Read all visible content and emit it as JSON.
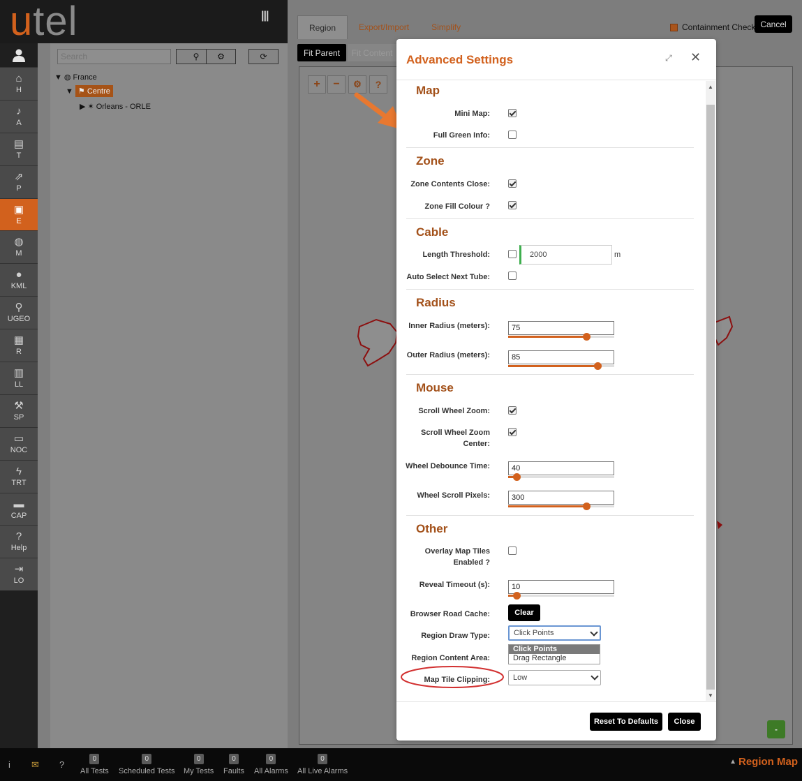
{
  "logo": {
    "u": "u",
    "rest": "tel"
  },
  "nav": [
    {
      "key": "home",
      "icon": "home-icon",
      "glyph": "⌂",
      "label": "H"
    },
    {
      "key": "alarms",
      "icon": "bell-icon",
      "glyph": "♪",
      "label": "A"
    },
    {
      "key": "tests",
      "icon": "chart-icon",
      "glyph": "▤",
      "label": "T"
    },
    {
      "key": "p",
      "icon": "share-icon",
      "glyph": "⇗",
      "label": "P"
    },
    {
      "key": "e",
      "icon": "chip-icon",
      "glyph": "▣",
      "label": "E",
      "active": true
    },
    {
      "key": "map",
      "icon": "globe-icon",
      "glyph": "◍",
      "label": "M"
    },
    {
      "key": "kml",
      "icon": "map-marker-icon",
      "glyph": "●",
      "label": "KML"
    },
    {
      "key": "ugeo",
      "icon": "pin-icon",
      "glyph": "⚲",
      "label": "UGEO"
    },
    {
      "key": "r",
      "icon": "document-icon",
      "glyph": "▦",
      "label": "R"
    },
    {
      "key": "ll",
      "icon": "book-icon",
      "glyph": "▥",
      "label": "LL"
    },
    {
      "key": "sp",
      "icon": "wrench-icon",
      "glyph": "⚒",
      "label": "SP"
    },
    {
      "key": "noc",
      "icon": "laptop-icon",
      "glyph": "▭",
      "label": "NOC"
    },
    {
      "key": "trt",
      "icon": "bolt-icon",
      "glyph": "ϟ",
      "label": "TRT"
    },
    {
      "key": "cap",
      "icon": "warehouse-icon",
      "glyph": "▬",
      "label": "CAP"
    },
    {
      "key": "help",
      "icon": "question-icon",
      "glyph": "?",
      "label": "Help"
    },
    {
      "key": "lo",
      "icon": "logout-icon",
      "glyph": "⇥",
      "label": "LO"
    }
  ],
  "tree": {
    "search_placeholder": "Search",
    "root": "France",
    "child": "Centre",
    "leaf": "Orleans - ORLE"
  },
  "tabs": [
    "Region",
    "Export/Import",
    "Simplify"
  ],
  "toolbar": {
    "containment_label": "Containment Checks",
    "cancel_label": "Cancel",
    "fit_parent": "Fit Parent",
    "fit_content": "Fit Content"
  },
  "map_tools": {
    "zoom_in": "+",
    "zoom_out": "−",
    "settings": "⚙",
    "help": "?"
  },
  "modal": {
    "title": "Advanced Settings",
    "sections": {
      "map": {
        "title": "Map",
        "mini_map_label": "Mini Map:",
        "mini_map_checked": true,
        "full_green_label": "Full Green Info:",
        "full_green_checked": false
      },
      "zone": {
        "title": "Zone",
        "contents_close_label": "Zone Contents Close:",
        "fill_colour_label": "Zone Fill Colour ?"
      },
      "cable": {
        "title": "Cable",
        "length_label": "Length Threshold:",
        "length_value": "2000",
        "length_unit": "m",
        "auto_select_label": "Auto Select Next Tube:"
      },
      "radius": {
        "title": "Radius",
        "inner_label": "Inner Radius (meters):",
        "inner_value": "75",
        "inner_fraction": 0.74,
        "outer_label": "Outer Radius (meters):",
        "outer_value": "85",
        "outer_fraction": 0.84
      },
      "mouse": {
        "title": "Mouse",
        "scroll_zoom_label": "Scroll Wheel Zoom:",
        "scroll_zoom_center_label_1": "Scroll Wheel Zoom",
        "scroll_zoom_center_label_2": "Center:",
        "debounce_label": "Wheel Debounce Time:",
        "debounce_value": "40",
        "debounce_fraction": 0.08,
        "scroll_pixels_label": "Wheel Scroll Pixels:",
        "scroll_pixels_value": "300",
        "scroll_pixels_fraction": 0.74
      },
      "other": {
        "title": "Other",
        "overlay_label_1": "Overlay Map Tiles",
        "overlay_label_2": "Enabled ?",
        "reveal_label": "Reveal Timeout (s):",
        "reveal_value": "10",
        "reveal_fraction": 0.08,
        "cache_label": "Browser Road Cache:",
        "clear_label": "Clear",
        "draw_type_label": "Region Draw Type:",
        "draw_type_value": "Click Points",
        "draw_type_options": [
          "Click Points",
          "Drag Rectangle"
        ],
        "content_area_label": "Region Content Area:",
        "clipping_label": "Map Tile Clipping:",
        "clipping_value": "Low"
      }
    },
    "reset_label": "Reset To Defaults",
    "close_label": "Close"
  },
  "bottom": {
    "items": [
      {
        "label": "All Tests",
        "count": "0"
      },
      {
        "label": "Scheduled Tests",
        "count": "0"
      },
      {
        "label": "My Tests",
        "count": "0"
      },
      {
        "label": "Faults",
        "count": "0"
      },
      {
        "label": "All Alarms",
        "count": "0"
      },
      {
        "label": "All Live Alarms",
        "count": "0"
      }
    ],
    "region_map": "Region Map",
    "minimize": "-"
  }
}
